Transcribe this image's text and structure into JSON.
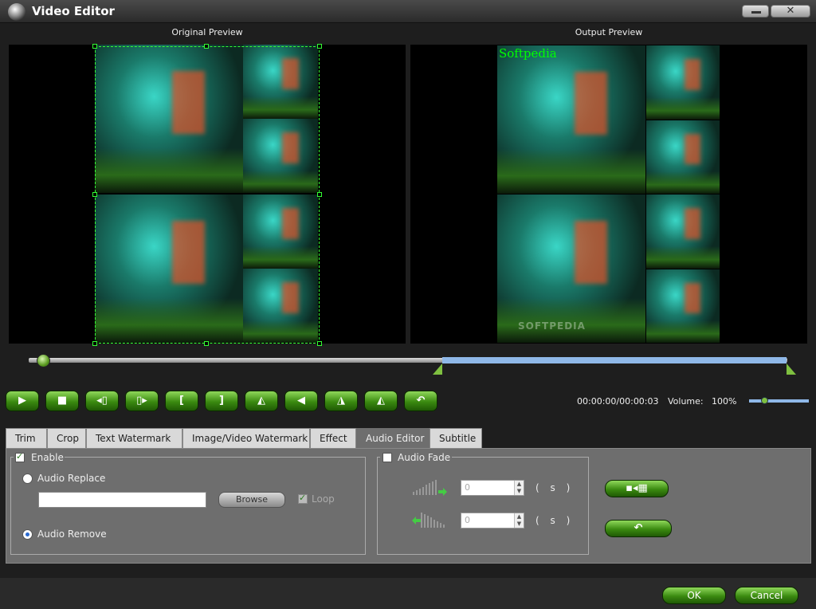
{
  "window": {
    "title": "Video Editor",
    "close_glyph": "✕"
  },
  "preview": {
    "original_caption": "Original Preview",
    "output_caption": "Output Preview",
    "watermark_text": "Softpedia",
    "logo_text": "SOFTPEDIA"
  },
  "timeline": {
    "position_fraction": 0.02,
    "selection_start_fraction": 0.54,
    "selection_end_fraction": 1.0
  },
  "controls": [
    {
      "name": "play-button",
      "icon": "play-icon",
      "glyph": "▶"
    },
    {
      "name": "stop-button",
      "icon": "stop-icon",
      "glyph": "■"
    },
    {
      "name": "prev-frame-button",
      "icon": "prev-frame-icon",
      "glyph": "◂▯"
    },
    {
      "name": "next-frame-button",
      "icon": "next-frame-icon",
      "glyph": "▯▸"
    },
    {
      "name": "set-start-button",
      "icon": "bracket-left-icon",
      "glyph": "["
    },
    {
      "name": "set-end-button",
      "icon": "bracket-right-icon",
      "glyph": "]"
    },
    {
      "name": "flip-horizontal-button",
      "icon": "flip-horizontal-icon",
      "glyph": "◭"
    },
    {
      "name": "flip-vertical-button",
      "icon": "flip-vertical-icon",
      "glyph": "◀"
    },
    {
      "name": "rotate-left-button",
      "icon": "rotate-left-icon",
      "glyph": "◮"
    },
    {
      "name": "rotate-right-button",
      "icon": "rotate-right-icon",
      "glyph": "◭"
    },
    {
      "name": "reset-button",
      "icon": "undo-icon",
      "glyph": "↶"
    }
  ],
  "status": {
    "time": "00:00:00/00:00:03",
    "volume_label": "Volume:",
    "volume_value": "100%",
    "volume_fraction": 0.2
  },
  "tabs": [
    "Trim",
    "Crop",
    "Text Watermark",
    "Image/Video Watermark",
    "Effect",
    "Audio Editor",
    "Subtitle"
  ],
  "active_tab": "Audio Editor",
  "audio": {
    "enable_label": "Enable",
    "enable_checked": true,
    "replace_label": "Audio Replace",
    "path_value": "",
    "browse_label": "Browse",
    "loop_label": "Loop",
    "remove_label": "Audio Remove",
    "fade_label": "Audio Fade",
    "fade_in_value": "0",
    "fade_out_value": "0",
    "unit": "( s )",
    "apply_glyph": "▪◂▦",
    "undo_glyph": "↶"
  },
  "footer": {
    "ok_label": "OK",
    "cancel_label": "Cancel"
  },
  "colors": {
    "accent_green": "#5aa020",
    "timeline_blue": "#8fb8e8",
    "crop_guide": "#33ff33"
  }
}
